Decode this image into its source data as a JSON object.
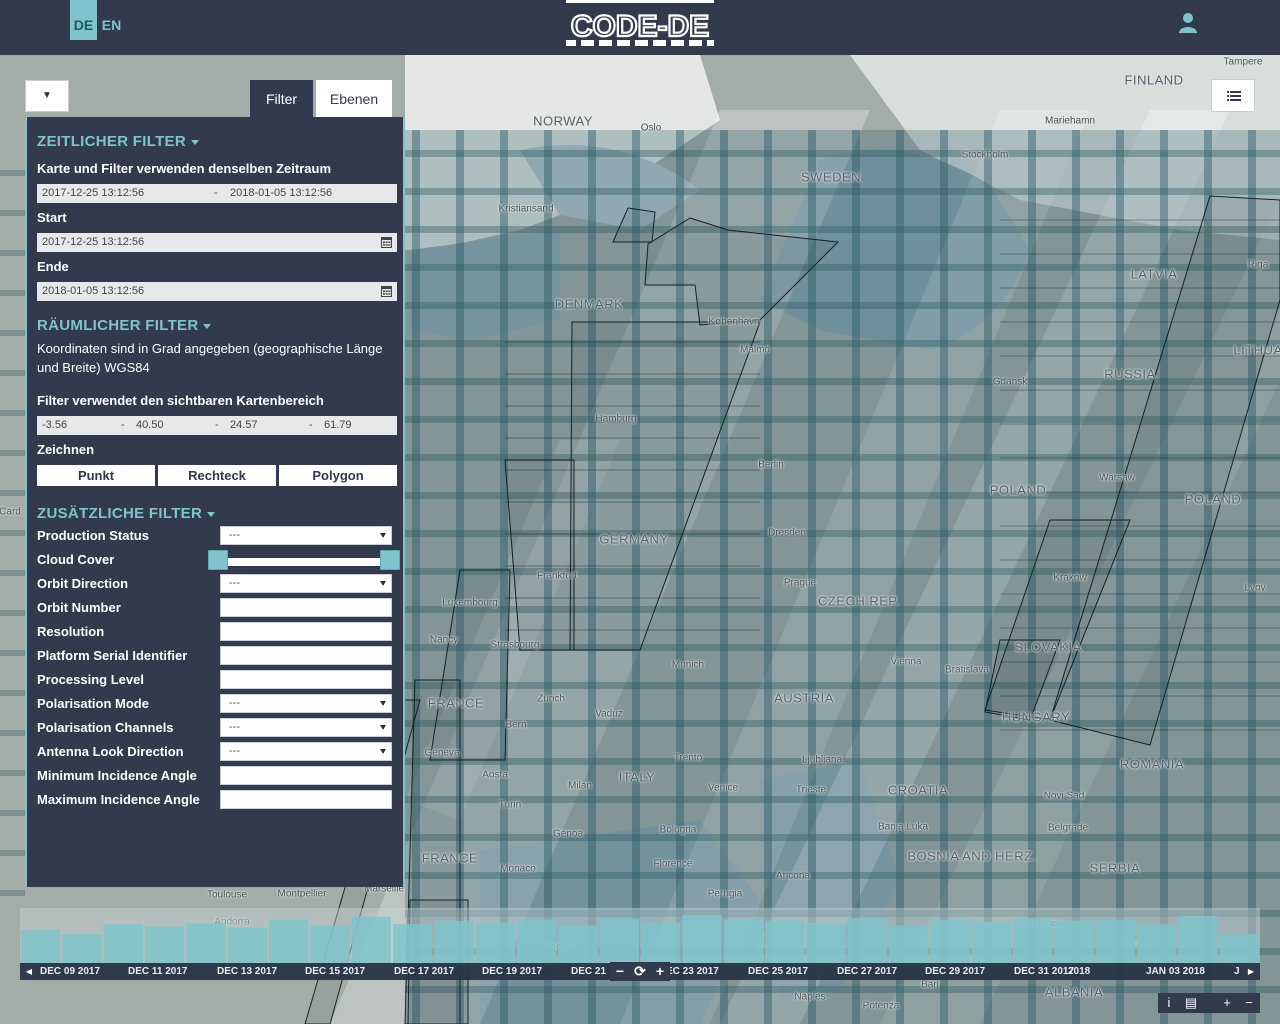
{
  "header": {
    "lang_de": "DE",
    "lang_en": "EN",
    "logo_text": "CODE-DE"
  },
  "tabs": {
    "filter": "Filter",
    "ebenen": "Ebenen"
  },
  "time_filter": {
    "title": "ZEITLICHER FILTER",
    "hint": "Karte und Filter verwenden denselben Zeitraum",
    "range_from": "2017-12-25 13:12:56",
    "range_sep": "-",
    "range_to": "2018-01-05 13:12:56",
    "start_label": "Start",
    "start_value": "2017-12-25 13:12:56",
    "end_label": "Ende",
    "end_value": "2018-01-05 13:12:56"
  },
  "spatial_filter": {
    "title": "RÄUMLICHER FILTER",
    "hint": "Koordinaten sind in Grad angegeben (geographische Länge und Breite) WGS84",
    "area_label": "Filter verwendet den sichtbaren Kartenbereich",
    "coords": [
      "-3.56",
      "40.50",
      "24.57",
      "61.79"
    ],
    "coord_sep": "-",
    "draw_label": "Zeichnen",
    "draw_buttons": [
      "Punkt",
      "Rechteck",
      "Polygon"
    ]
  },
  "extra_filter": {
    "title": "ZUSÄTZLICHE FILTER",
    "rows": [
      {
        "label": "Production Status",
        "value": "---"
      },
      {
        "label": "Cloud Cover",
        "value": ""
      },
      {
        "label": "Orbit Direction",
        "value": "---"
      },
      {
        "label": "Orbit Number",
        "value": ""
      },
      {
        "label": "Resolution",
        "value": ""
      },
      {
        "label": "Platform Serial Identifier",
        "value": ""
      },
      {
        "label": "Processing Level",
        "value": ""
      },
      {
        "label": "Polarisation Mode",
        "value": "---"
      },
      {
        "label": "Polarisation Channels",
        "value": "---"
      },
      {
        "label": "Antenna Look Direction",
        "value": "---"
      },
      {
        "label": "Minimum Incidence Angle",
        "value": ""
      },
      {
        "label": "Maximum Incidence Angle",
        "value": ""
      }
    ],
    "cloud_cover_range": [
      0,
      100
    ]
  },
  "map": {
    "countries": [
      {
        "name": "NORWAY"
      },
      {
        "name": "SWEDEN"
      },
      {
        "name": "FINLAND"
      },
      {
        "name": "DENMARK"
      },
      {
        "name": "LATVIA"
      },
      {
        "name": "RUSSIA"
      },
      {
        "name": "LITHUA"
      },
      {
        "name": "GERMANY"
      },
      {
        "name": "POLAND"
      },
      {
        "name": "POLAND"
      },
      {
        "name": "CZECH REP."
      },
      {
        "name": "FRANCE"
      },
      {
        "name": "AUSTRIA"
      },
      {
        "name": "SLOVAKIA"
      },
      {
        "name": "HUNGARY"
      },
      {
        "name": "ITALY"
      },
      {
        "name": "ROMANIA"
      },
      {
        "name": "CROATIA"
      },
      {
        "name": "BOSNIA AND HERZ."
      },
      {
        "name": "SERBIA"
      },
      {
        "name": "ALBANIA"
      },
      {
        "name": "FRANCE"
      }
    ],
    "cities": [
      "Oslo",
      "Stockholm",
      "Mariehamn",
      "Tampere",
      "Kristiansand",
      "København",
      "Malmö",
      "Riga",
      "Gdansk",
      "Hamburg",
      "Berlin",
      "Warsaw",
      "Dresden",
      "Frankfurt",
      "Prague",
      "Kraków",
      "Lvov",
      "Luxembourg",
      "Nancy",
      "Strasbourg",
      "Munich",
      "Vienna",
      "Bratislava",
      "Zürich",
      "Vaduz",
      "Bern",
      "Geneva",
      "Aosta",
      "Trento",
      "Ljubljana",
      "Milan",
      "Venice",
      "Trieste",
      "Turin",
      "Genoa",
      "Bologna",
      "Banja Luka",
      "Novi Sad",
      "Belgrade",
      "Florence",
      "Monaco",
      "Toulouse",
      "Montpellier",
      "Marseille",
      "Ancona",
      "Perugia",
      "Bari",
      "Naples",
      "Potenza",
      "Card",
      "Ajaccio",
      "Skopje",
      "Podgorica",
      "Andorra"
    ]
  },
  "timeline": {
    "ticks": [
      "DEC 09 2017",
      "DEC 11 2017",
      "DEC 13 2017",
      "DEC 15 2017",
      "DEC 17 2017",
      "DEC 19 2017",
      "DEC 21",
      "EC 23 2017",
      "DEC 25 2017",
      "DEC 27 2017",
      "DEC 29 2017",
      "DEC 31 2017",
      "2018",
      "JAN 03 2018",
      "J"
    ],
    "bars": [
      0.62,
      0.55,
      0.72,
      0.68,
      0.74,
      0.66,
      0.8,
      0.7,
      0.85,
      0.72,
      0.78,
      0.74,
      0.8,
      0.7,
      0.82,
      0.75,
      0.88,
      0.8,
      0.78,
      0.74,
      0.82,
      0.7,
      0.8,
      0.76,
      0.82,
      0.78,
      0.8,
      0.72,
      0.86,
      0.55
    ],
    "controls": {
      "minus": "−",
      "refresh": "⟳",
      "plus": "+"
    }
  },
  "map_controls": {
    "info": "i",
    "zoom_in": "+",
    "zoom_out": "−"
  }
}
